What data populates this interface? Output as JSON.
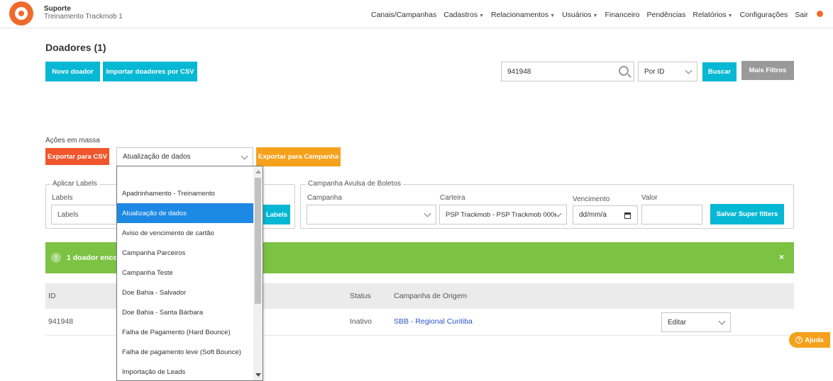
{
  "header": {
    "org_title": "Suporte",
    "org_subtitle": "Treinamento Trackmob 1",
    "nav": [
      {
        "label": "Canais/Campanhas",
        "dropdown": false
      },
      {
        "label": "Cadastros",
        "dropdown": true
      },
      {
        "label": "Relacionamentos",
        "dropdown": true
      },
      {
        "label": "Usuários",
        "dropdown": true
      },
      {
        "label": "Financeiro",
        "dropdown": false
      },
      {
        "label": "Pendências",
        "dropdown": false
      },
      {
        "label": "Relatórios",
        "dropdown": true
      },
      {
        "label": "Configurações",
        "dropdown": false
      },
      {
        "label": "Sair",
        "dropdown": false
      }
    ]
  },
  "page": {
    "title": "Doadores (1)",
    "new_donor": "Novo doador",
    "import_csv": "Importar doadores por CSV",
    "search_value": "941948",
    "search_by": "Por ID",
    "search_button": "Buscar",
    "more_filters": "Mais Filtros"
  },
  "bulk": {
    "label": "Ações em massa",
    "export_csv": "Exportar para CSV",
    "selected_action": "Atualização de dados",
    "export_campaign": "Exportar para Campanha"
  },
  "labels_box": {
    "legend": "Aplicar Labels",
    "field_label": "Labels",
    "placeholder": "Labels",
    "apply_button": "Labels"
  },
  "boleto_box": {
    "legend": "Campanha Avulsa de Boletos",
    "campanha_label": "Campanha",
    "carteira_label": "Carteira",
    "carteira_value": "PSP Trackmob - PSP Trackmob 000(",
    "vencimento_label": "Vencimento",
    "vencimento_value": "dd/mm/a",
    "valor_label": "Valor",
    "save_button": "Salvar Super filters"
  },
  "alert": {
    "icon": "!",
    "text": "1 doador encor",
    "close": "×"
  },
  "table": {
    "headers": {
      "id": "ID",
      "status": "Status",
      "campaign": "Campanha de Origem"
    },
    "rows": [
      {
        "id": "941948",
        "status": "Inativo",
        "campaign": "SBB - Regional Curitiba",
        "action": "Editar"
      }
    ]
  },
  "dropdown": {
    "items": [
      "",
      "Apadrinhamento - Treinamento",
      "Atualização de dados",
      "Aviso de vencimento de cartão",
      "Campanha Parceiros",
      "Campanha Teste",
      "Doe Bahia - Salvador",
      "Doe Bahia - Santa Bárbara",
      "Falha de Pagamento (Hard Bounce)",
      "Falha de pagamento leve (Soft Bounce)",
      "Importação de Leads"
    ],
    "selected_index": 2
  },
  "help": {
    "label": "Ajuda",
    "icon": "?"
  },
  "colors": {
    "teal": "#07b8d4",
    "orange": "#f5a11c",
    "red": "#f0552b",
    "green": "#7cc243",
    "select_blue": "#1e88e5"
  }
}
